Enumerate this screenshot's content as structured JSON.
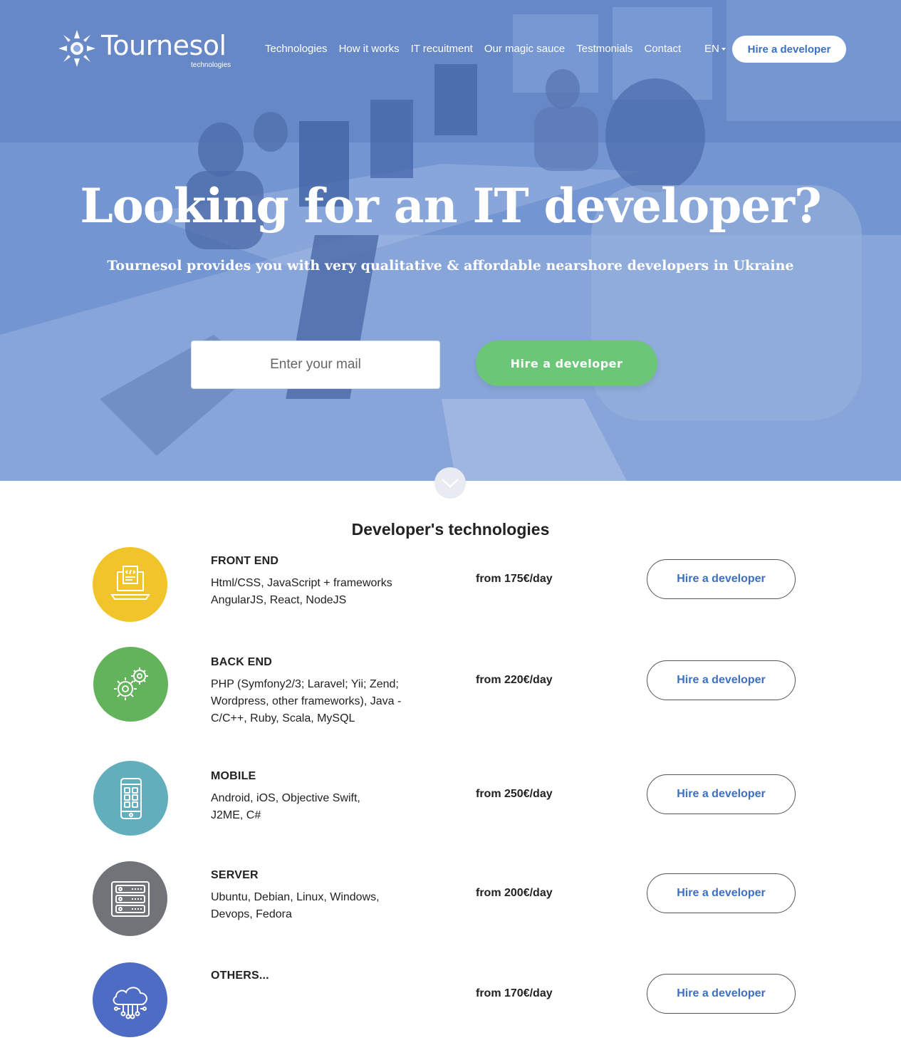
{
  "header": {
    "logo_text": "Tournesol",
    "logo_sub": "technologies",
    "nav": [
      "Technologies",
      "How it works",
      "IT recuitment",
      "Our magic sauce",
      "Testmonials",
      "Contact"
    ],
    "language": "EN",
    "cta": "Hire a developer"
  },
  "hero": {
    "title": "Looking for an IT developer?",
    "subtitle": "Tournesol provides you with very qualitative & affordable nearshore developers in Ukraine",
    "email_placeholder": "Enter your mail",
    "cta": "Hire a developer"
  },
  "technologies": {
    "title": "Developer's technologies",
    "items": [
      {
        "name": "FRONT END",
        "desc": "Html/CSS, JavaScript + frameworks AngularJS, React, NodeJS",
        "price": "from 175€/day",
        "cta": "Hire a developer",
        "color": "#f2c42b",
        "icon": "laptop-code-icon"
      },
      {
        "name": "BACK END",
        "desc": "PHP (Symfony2/3; Laravel; Yii; Zend; Wordpress, other frameworks), Java - C/C++, Ruby, Scala, MySQL",
        "price": "from 220€/day",
        "cta": "Hire a developer",
        "color": "#62b35c",
        "icon": "gears-icon"
      },
      {
        "name": "MOBILE",
        "desc": "Android, iOS, Objective Swift, J2ME, C#",
        "price": "from 250€/day",
        "cta": "Hire a developer",
        "color": "#63aebc",
        "icon": "smartphone-icon"
      },
      {
        "name": "SERVER",
        "desc": "Ubuntu, Debian, Linux, Windows, Devops, Fedora",
        "price": "from 200€/day",
        "cta": "Hire a developer",
        "color": "#707479",
        "icon": "server-icon"
      },
      {
        "name": "OTHERS...",
        "desc": "",
        "price": "from 170€/day",
        "cta": "Hire a developer",
        "color": "#4e6cc4",
        "icon": "cloud-network-icon"
      }
    ]
  }
}
